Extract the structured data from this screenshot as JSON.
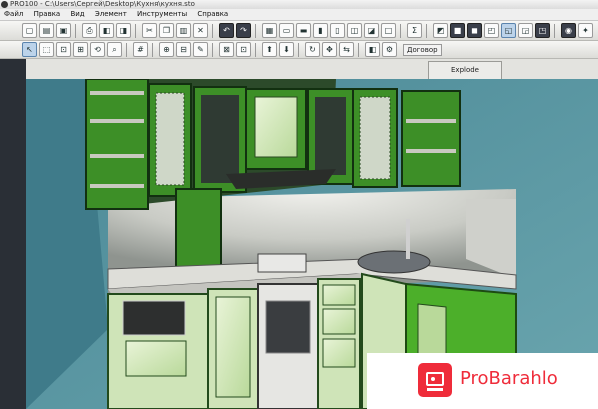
{
  "window": {
    "title": "PRO100 - C:\\Users\\Сергей\\Desktop\\Кухня\\кухня.sto"
  },
  "menu": [
    "Файл",
    "Правка",
    "Вид",
    "Элемент",
    "Инструменты",
    "Справка"
  ],
  "toolbar2": {
    "dogovor_label": "Договор"
  },
  "tabs": {
    "explode_label": "Explode"
  },
  "watermark": {
    "text": "ProBarahlo"
  },
  "colors": {
    "cabinet_green": "#4caf2a",
    "wall_blue": "#4f8e9b",
    "countertop": "#d8d8d3",
    "brand_red": "#ef2c3a"
  }
}
